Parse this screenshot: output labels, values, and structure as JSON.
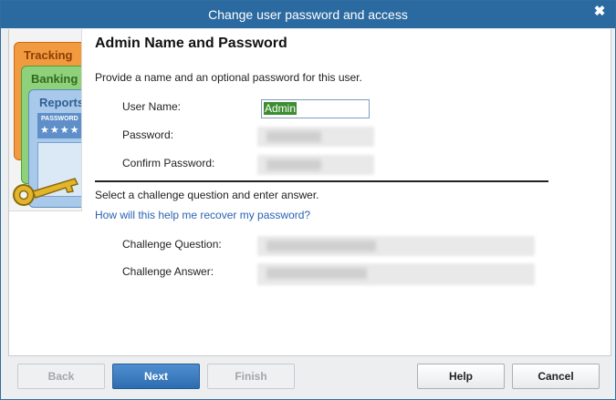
{
  "window": {
    "title": "Change user password and access",
    "close_glyph": "✖"
  },
  "illustration": {
    "cards": [
      "Tracking",
      "Banking",
      "Reports"
    ],
    "password_label": "PASSWORD",
    "password_stars": "★★★★"
  },
  "form": {
    "heading": "Admin Name and Password",
    "intro": "Provide a name and an optional password for this user.",
    "user_name_label": "User Name:",
    "user_name_value": "Admin",
    "password_label": "Password:",
    "confirm_password_label": "Confirm Password:",
    "challenge_intro": "Select a challenge question and enter answer.",
    "recover_link": "How will this help me recover my password?",
    "challenge_question_label": "Challenge Question:",
    "challenge_answer_label": "Challenge Answer:"
  },
  "buttons": {
    "back": "Back",
    "next": "Next",
    "finish": "Finish",
    "help": "Help",
    "cancel": "Cancel"
  },
  "colors": {
    "titlebar": "#2b6aa0",
    "selection": "#3c8d2f",
    "link": "#2a62b3",
    "primary_button": "#2e6cb0"
  }
}
